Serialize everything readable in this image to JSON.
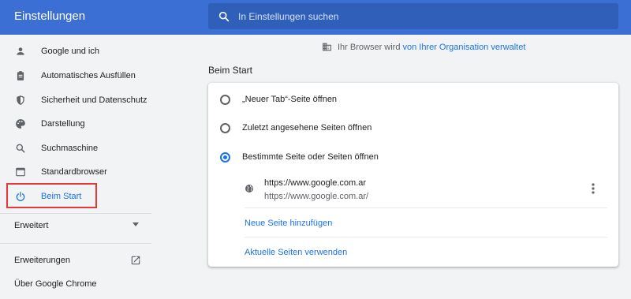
{
  "header": {
    "title": "Einstellungen",
    "search_placeholder": "In Einstellungen suchen"
  },
  "sidebar": {
    "items": [
      {
        "label": "Google und ich",
        "icon": "person-icon"
      },
      {
        "label": "Automatisches Ausfüllen",
        "icon": "clipboard-icon"
      },
      {
        "label": "Sicherheit und Datenschutz",
        "icon": "shield-icon"
      },
      {
        "label": "Darstellung",
        "icon": "palette-icon"
      },
      {
        "label": "Suchmaschine",
        "icon": "search-icon"
      },
      {
        "label": "Standardbrowser",
        "icon": "browser-icon"
      },
      {
        "label": "Beim Start",
        "icon": "power-icon",
        "active": true
      }
    ],
    "advanced_label": "Erweitert",
    "extensions_label": "Erweiterungen",
    "about_label": "Über Google Chrome"
  },
  "managed_notice": {
    "text": "Ihr Browser wird",
    "link": "von Ihrer Organisation verwaltet"
  },
  "startup": {
    "title": "Beim Start",
    "options": [
      {
        "label": "„Neuer Tab“-Seite öffnen",
        "checked": false
      },
      {
        "label": "Zuletzt angesehene Seiten öffnen",
        "checked": false
      },
      {
        "label": "Bestimmte Seite oder Seiten öffnen",
        "checked": true
      }
    ],
    "site": {
      "name": "https://www.google.com.ar",
      "url": "https://www.google.com.ar/"
    },
    "add_page_label": "Neue Seite hinzufügen",
    "use_current_label": "Aktuelle Seiten verwenden"
  },
  "colors": {
    "header_bg": "#3b6fd4",
    "accent": "#1a73e8",
    "highlight": "#e53935"
  }
}
